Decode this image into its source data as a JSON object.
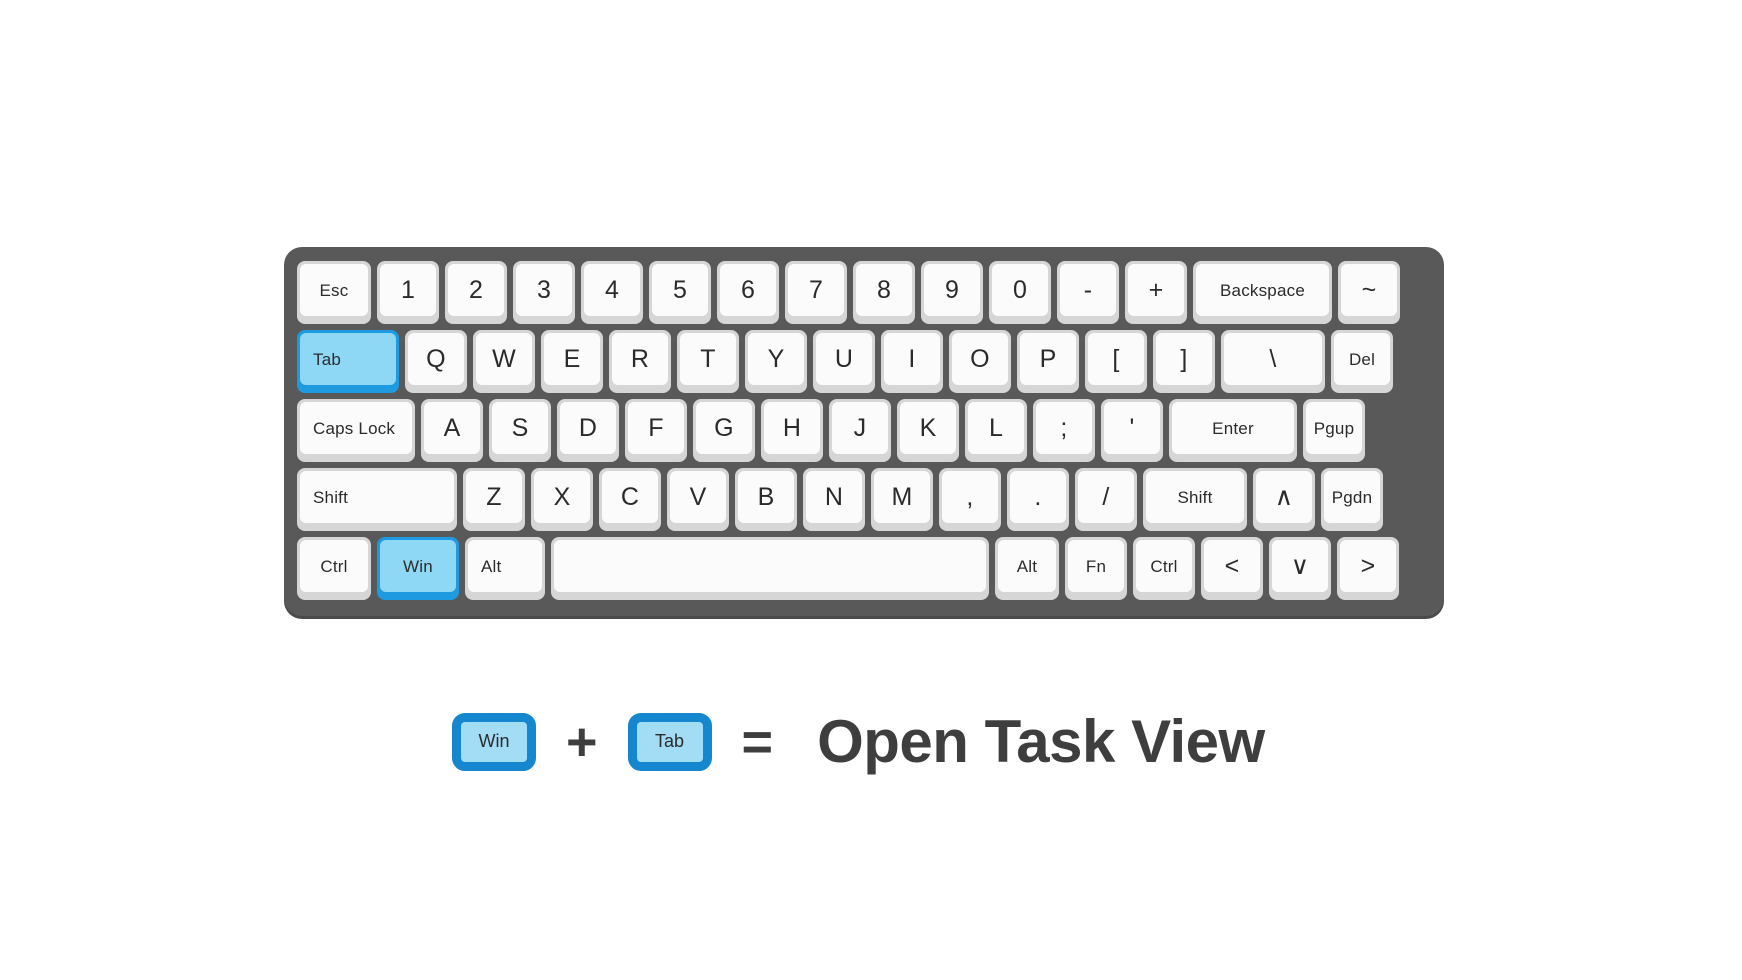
{
  "colors": {
    "background": "#ffffff",
    "frame": "#595959",
    "key_base": "#d6d6d6",
    "key_face": "#fbfbfb",
    "key_text": "#2b2b2b",
    "highlight_border": "#1e9ae0",
    "highlight_face": "#8ed8f5",
    "legend_key_border": "#1587ce",
    "legend_key_face": "#a3dcf5",
    "legend_text": "#3e3e3e"
  },
  "keyboard": {
    "rows": [
      {
        "name": "number-row",
        "keys": [
          {
            "label": "Esc",
            "style": "word",
            "width": "w-esc",
            "highlight": false
          },
          {
            "label": "1",
            "style": "char",
            "width": "",
            "highlight": false
          },
          {
            "label": "2",
            "style": "char",
            "width": "",
            "highlight": false
          },
          {
            "label": "3",
            "style": "char",
            "width": "",
            "highlight": false
          },
          {
            "label": "4",
            "style": "char",
            "width": "",
            "highlight": false
          },
          {
            "label": "5",
            "style": "char",
            "width": "",
            "highlight": false
          },
          {
            "label": "6",
            "style": "char",
            "width": "",
            "highlight": false
          },
          {
            "label": "7",
            "style": "char",
            "width": "",
            "highlight": false
          },
          {
            "label": "8",
            "style": "char",
            "width": "",
            "highlight": false
          },
          {
            "label": "9",
            "style": "char",
            "width": "",
            "highlight": false
          },
          {
            "label": "0",
            "style": "char",
            "width": "",
            "highlight": false
          },
          {
            "label": "-",
            "style": "char",
            "width": "",
            "highlight": false
          },
          {
            "label": "+",
            "style": "char",
            "width": "",
            "highlight": false
          },
          {
            "label": "Backspace",
            "style": "word",
            "width": "w-back",
            "highlight": false
          },
          {
            "label": "~",
            "style": "char",
            "width": "",
            "highlight": false
          }
        ]
      },
      {
        "name": "top-letter-row",
        "keys": [
          {
            "label": "Tab",
            "style": "word word-left",
            "width": "w-tab",
            "highlight": true
          },
          {
            "label": "Q",
            "style": "char",
            "width": "",
            "highlight": false
          },
          {
            "label": "W",
            "style": "char",
            "width": "",
            "highlight": false
          },
          {
            "label": "E",
            "style": "char",
            "width": "",
            "highlight": false
          },
          {
            "label": "R",
            "style": "char",
            "width": "",
            "highlight": false
          },
          {
            "label": "T",
            "style": "char",
            "width": "",
            "highlight": false
          },
          {
            "label": "Y",
            "style": "char",
            "width": "",
            "highlight": false
          },
          {
            "label": "U",
            "style": "char",
            "width": "",
            "highlight": false
          },
          {
            "label": "I",
            "style": "char",
            "width": "",
            "highlight": false
          },
          {
            "label": "O",
            "style": "char",
            "width": "",
            "highlight": false
          },
          {
            "label": "P",
            "style": "char",
            "width": "",
            "highlight": false
          },
          {
            "label": "[",
            "style": "char",
            "width": "",
            "highlight": false
          },
          {
            "label": "]",
            "style": "char",
            "width": "",
            "highlight": false
          },
          {
            "label": "\\",
            "style": "char",
            "width": "w-bslash",
            "highlight": false
          },
          {
            "label": "Del",
            "style": "word",
            "width": "",
            "highlight": false
          }
        ]
      },
      {
        "name": "home-row",
        "keys": [
          {
            "label": "Caps Lock",
            "style": "word word-left",
            "width": "w-caps",
            "highlight": false
          },
          {
            "label": "A",
            "style": "char",
            "width": "",
            "highlight": false
          },
          {
            "label": "S",
            "style": "char",
            "width": "",
            "highlight": false
          },
          {
            "label": "D",
            "style": "char",
            "width": "",
            "highlight": false
          },
          {
            "label": "F",
            "style": "char",
            "width": "",
            "highlight": false
          },
          {
            "label": "G",
            "style": "char",
            "width": "",
            "highlight": false
          },
          {
            "label": "H",
            "style": "char",
            "width": "",
            "highlight": false
          },
          {
            "label": "J",
            "style": "char",
            "width": "",
            "highlight": false
          },
          {
            "label": "K",
            "style": "char",
            "width": "",
            "highlight": false
          },
          {
            "label": "L",
            "style": "char",
            "width": "",
            "highlight": false
          },
          {
            "label": ";",
            "style": "char",
            "width": "",
            "highlight": false
          },
          {
            "label": "'",
            "style": "char",
            "width": "",
            "highlight": false
          },
          {
            "label": "Enter",
            "style": "word",
            "width": "w-enter",
            "highlight": false
          },
          {
            "label": "Pgup",
            "style": "word",
            "width": "",
            "highlight": false
          }
        ]
      },
      {
        "name": "bottom-letter-row",
        "keys": [
          {
            "label": "Shift",
            "style": "word word-left",
            "width": "w-shiftL",
            "highlight": false
          },
          {
            "label": "Z",
            "style": "char",
            "width": "",
            "highlight": false
          },
          {
            "label": "X",
            "style": "char",
            "width": "",
            "highlight": false
          },
          {
            "label": "C",
            "style": "char",
            "width": "",
            "highlight": false
          },
          {
            "label": "V",
            "style": "char",
            "width": "",
            "highlight": false
          },
          {
            "label": "B",
            "style": "char",
            "width": "",
            "highlight": false
          },
          {
            "label": "N",
            "style": "char",
            "width": "",
            "highlight": false
          },
          {
            "label": "M",
            "style": "char",
            "width": "",
            "highlight": false
          },
          {
            "label": ",",
            "style": "char",
            "width": "",
            "highlight": false
          },
          {
            "label": ".",
            "style": "char",
            "width": "",
            "highlight": false
          },
          {
            "label": "/",
            "style": "char",
            "width": "",
            "highlight": false
          },
          {
            "label": "Shift",
            "style": "word",
            "width": "w-shiftR",
            "highlight": false
          },
          {
            "label": "∧",
            "style": "char",
            "width": "",
            "highlight": false
          },
          {
            "label": "Pgdn",
            "style": "word",
            "width": "",
            "highlight": false
          }
        ]
      },
      {
        "name": "modifier-row",
        "keys": [
          {
            "label": "Ctrl",
            "style": "word",
            "width": "w-ctrl",
            "highlight": false
          },
          {
            "label": "Win",
            "style": "word",
            "width": "w-win",
            "highlight": true
          },
          {
            "label": "Alt",
            "style": "word word-left",
            "width": "w-alt",
            "highlight": false
          },
          {
            "label": "",
            "style": "word",
            "width": "w-space",
            "highlight": false
          },
          {
            "label": "Alt",
            "style": "word",
            "width": "w-altR",
            "highlight": false
          },
          {
            "label": "Fn",
            "style": "word",
            "width": "w-fn",
            "highlight": false
          },
          {
            "label": "Ctrl",
            "style": "word",
            "width": "w-ctrlR",
            "highlight": false
          },
          {
            "label": "<",
            "style": "char",
            "width": "",
            "highlight": false
          },
          {
            "label": "∨",
            "style": "char",
            "width": "",
            "highlight": false
          },
          {
            "label": ">",
            "style": "char",
            "width": "",
            "highlight": false
          }
        ]
      }
    ]
  },
  "legend": {
    "key1": "Win",
    "operator_plus": "+",
    "key2": "Tab",
    "operator_equals": "=",
    "result": "Open Task View"
  }
}
